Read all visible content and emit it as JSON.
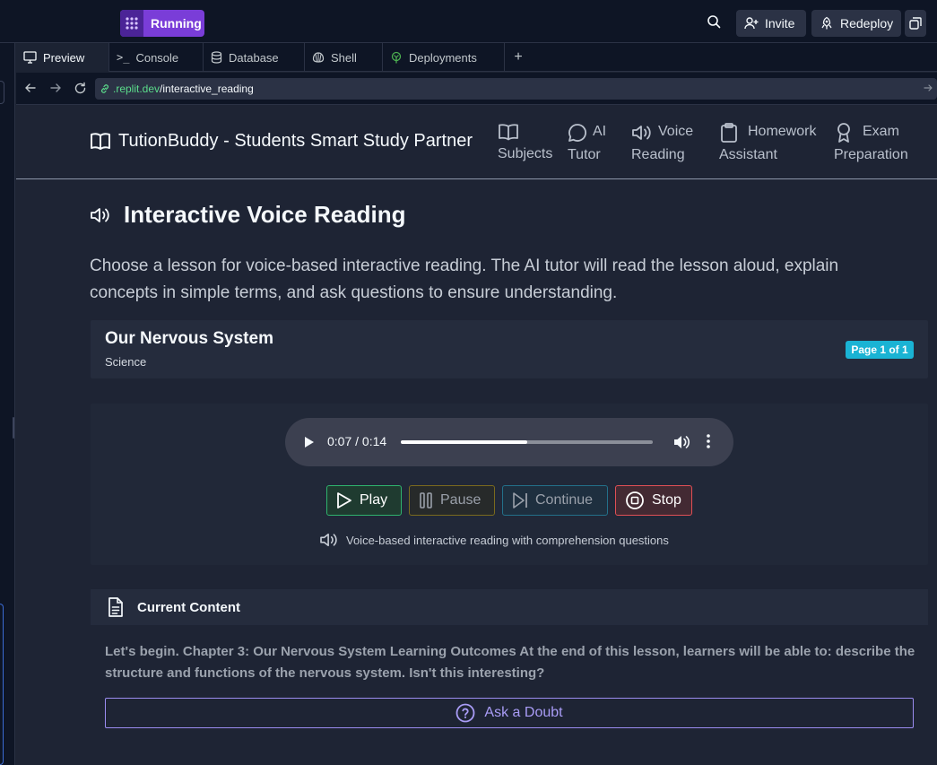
{
  "replit": {
    "run_button": "Running",
    "invite": "Invite",
    "redeploy": "Redeploy",
    "tabs": [
      {
        "label": "Preview",
        "icon": "monitor-icon"
      },
      {
        "label": "Console",
        "icon": "terminal-icon"
      },
      {
        "label": "Database",
        "icon": "database-icon"
      },
      {
        "label": "Shell",
        "icon": "shell-icon"
      },
      {
        "label": "Deployments",
        "icon": "deployments-icon"
      }
    ],
    "url_domain": ".replit.dev",
    "url_path": "/interactive_reading"
  },
  "app": {
    "brand": "TutionBuddy - Students Smart Study Partner",
    "nav": [
      {
        "line1": "",
        "line2": "Subjects",
        "icon": "book-icon"
      },
      {
        "line1": "AI",
        "line2": "Tutor",
        "icon": "chat-bubble-icon"
      },
      {
        "line1": "Voice",
        "line2": "Reading",
        "icon": "speaker-icon"
      },
      {
        "line1": "Homework",
        "line2": "Assistant",
        "icon": "clipboard-icon"
      },
      {
        "line1": "Exam",
        "line2": "Preparation",
        "icon": "award-icon"
      }
    ],
    "page_title": "Interactive Voice Reading",
    "intro": "Choose a lesson for voice-based interactive reading. The AI tutor will read the lesson aloud, explain concepts in simple terms, and ask questions to ensure understanding.",
    "lesson": {
      "title": "Our Nervous System",
      "subject": "Science",
      "page_badge": "Page 1 of 1"
    },
    "audio": {
      "time": "0:07 / 0:14",
      "progress": 0.5
    },
    "controls": {
      "play": "Play",
      "pause": "Pause",
      "continue": "Continue",
      "stop": "Stop"
    },
    "hint": "Voice-based interactive reading with comprehension questions",
    "current_content": {
      "heading": "Current Content",
      "text": "Let's begin. Chapter 3: Our Nervous System Learning Outcomes At the end of this lesson, learners will be able to: describe the structure and functions of the nervous system. Isn't this interesting?"
    },
    "ask_doubt": "Ask a Doubt"
  },
  "colors": {
    "run_purple": "#7a3dd8",
    "play_green": "#2fb36d",
    "stop_red": "#e04f55",
    "badge_cyan": "#1ab3d4",
    "doubt_purple": "#a99cf6"
  }
}
